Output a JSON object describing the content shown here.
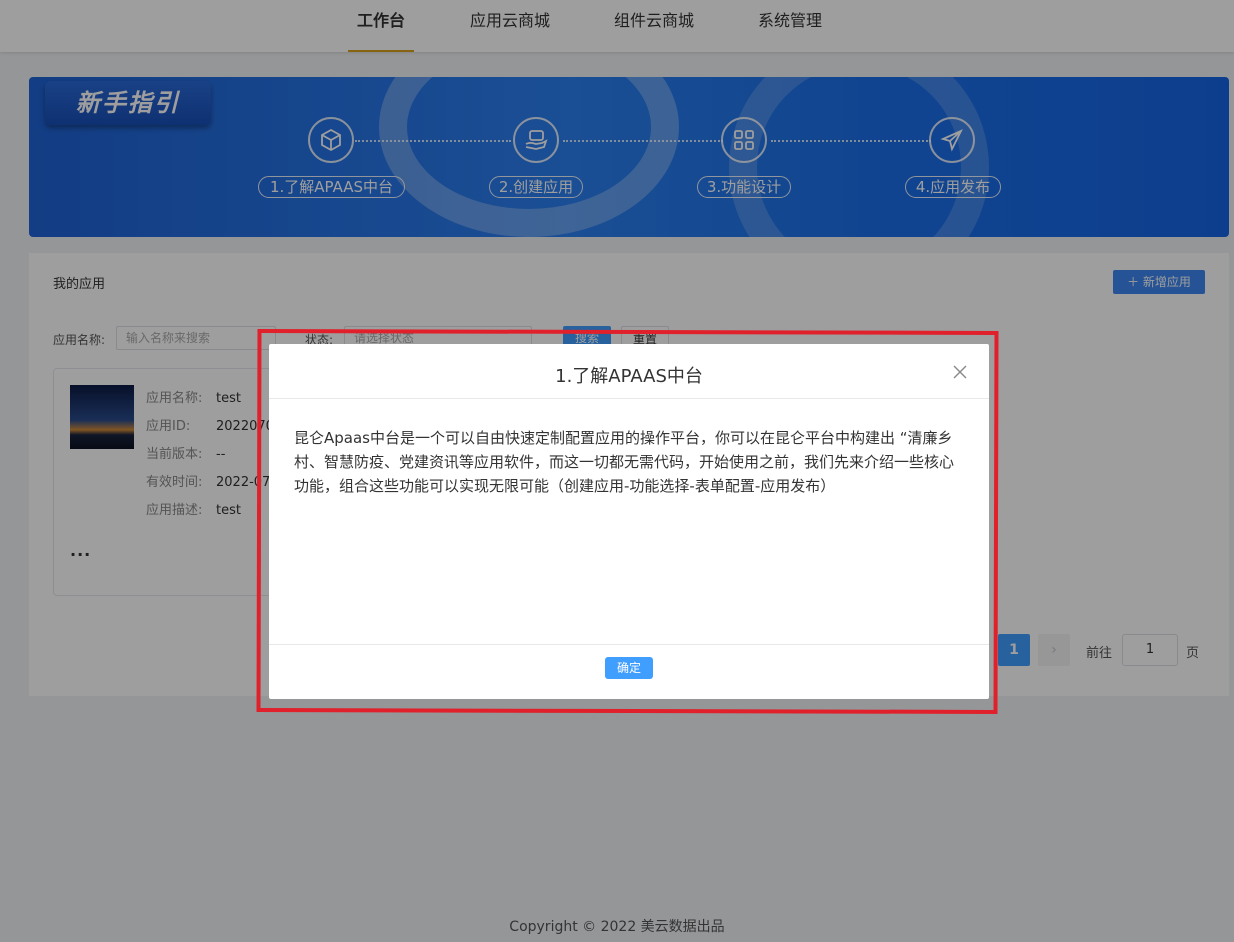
{
  "nav": {
    "items": [
      {
        "label": "工作台",
        "active": true
      },
      {
        "label": "应用云商城",
        "active": false
      },
      {
        "label": "组件云商城",
        "active": false
      },
      {
        "label": "系统管理",
        "active": false
      }
    ]
  },
  "guide": {
    "title": "新手指引",
    "steps": [
      {
        "label": "1.了解APAAS中台",
        "icon": "cube-icon"
      },
      {
        "label": "2.创建应用",
        "icon": "hand-card-icon"
      },
      {
        "label": "3.功能设计",
        "icon": "grid-icon"
      },
      {
        "label": "4.应用发布",
        "icon": "paper-plane-icon"
      }
    ]
  },
  "apps": {
    "title": "我的应用",
    "add_label": "＋ 新增应用",
    "filter": {
      "name_label": "应用名称:",
      "name_placeholder": "输入名称来搜索",
      "status_label": "状态:",
      "status_placeholder": "请选择状态",
      "search_label": "搜索",
      "reset_label": "重置"
    },
    "card": {
      "name_key": "应用名称:",
      "name_val": "test",
      "id_key": "应用ID:",
      "id_val": "2022070",
      "version_key": "当前版本:",
      "version_val": "--",
      "valid_key": "有效时间:",
      "valid_val": "2022-07",
      "desc_key": "应用描述:",
      "desc_val": "test",
      "more": "..."
    },
    "pagination": {
      "current": "1",
      "goto_label": "前往",
      "goto_value": "1",
      "page_suffix": "页"
    }
  },
  "footer": "Copyright © 2022 美云数据出品",
  "modal": {
    "title": "1.了解APAAS中台",
    "body": "昆仑Apaas中台是一个可以自由快速定制配置应用的操作平台，你可以在昆仑平台中构建出 “清廉乡村、智慧防疫、党建资讯等应用软件，而这一切都无需代码，开始使用之前，我们先来介绍一些核心功能，组合这些功能可以实现无限可能（创建应用-功能选择-表单配置-应用发布）",
    "ok_label": "确定"
  },
  "colors": {
    "primary": "#409eff",
    "nav_underline": "#d9a21e",
    "highlight_box": "#e0202a"
  }
}
